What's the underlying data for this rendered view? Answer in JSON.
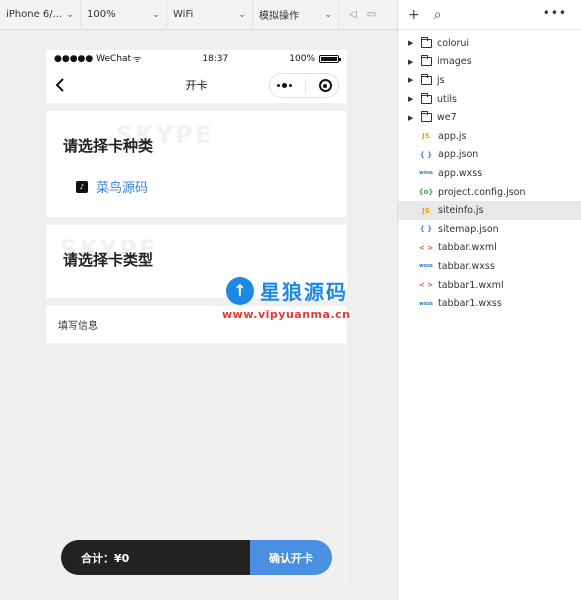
{
  "toolbar": {
    "device": "iPhone 6/...",
    "zoom": "100%",
    "network": "WiFi",
    "operation": "模拟操作"
  },
  "phone": {
    "status": {
      "carrier": "●●●●● WeChat",
      "time": "18:37",
      "battery": "100%"
    },
    "nav_title": "开卡",
    "card_one": {
      "title": "请选择卡种类",
      "watermark": "SKYPE",
      "item_label": "菜鸟源码"
    },
    "card_two": {
      "title": "请选择卡类型",
      "watermark": "SKYPE"
    },
    "info_label": "填写信息",
    "total_label": "合计：¥0",
    "confirm_label": "确认开卡"
  },
  "logo": {
    "name": "星狼源码",
    "url": "www.vipyuanma.cn"
  },
  "file_tree": {
    "folders": [
      "colorui",
      "images",
      "js",
      "utils",
      "we7"
    ],
    "files": [
      {
        "name": "app.js",
        "badge": "JS",
        "type": "js"
      },
      {
        "name": "app.json",
        "badge": "{ }",
        "type": "json"
      },
      {
        "name": "app.wxss",
        "badge": "wxss",
        "type": "wxss"
      },
      {
        "name": "project.config.json",
        "badge": "{o}",
        "type": "config"
      },
      {
        "name": "siteinfo.js",
        "badge": "JS",
        "type": "js",
        "selected": true
      },
      {
        "name": "sitemap.json",
        "badge": "{ }",
        "type": "json"
      },
      {
        "name": "tabbar.wxml",
        "badge": "< >",
        "type": "wxml"
      },
      {
        "name": "tabbar.wxss",
        "badge": "wxss",
        "type": "wxss"
      },
      {
        "name": "tabbar1.wxml",
        "badge": "< >",
        "type": "wxml"
      },
      {
        "name": "tabbar1.wxss",
        "badge": "wxss",
        "type": "wxss"
      }
    ]
  },
  "colors": {
    "accent": "#4a90e2",
    "link": "#3b7fd4",
    "dark_bar": "#222222"
  }
}
